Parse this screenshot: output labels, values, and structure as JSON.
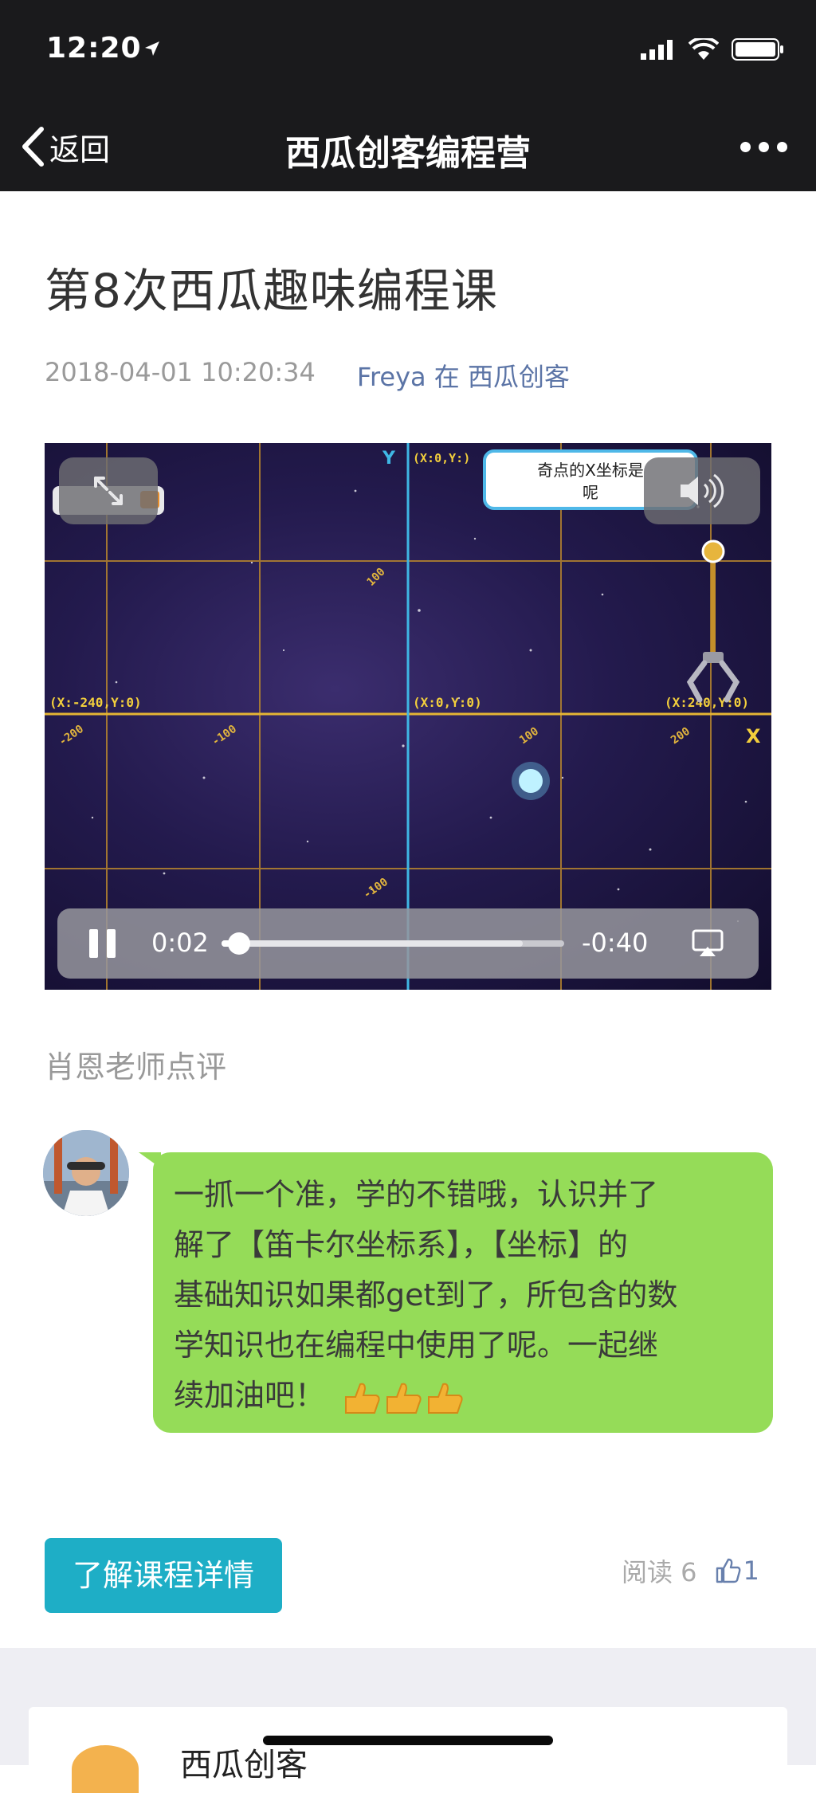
{
  "status_bar": {
    "time": "12:20",
    "icons": [
      "location-arrow-icon",
      "signal-icon",
      "wifi-icon",
      "battery-icon"
    ]
  },
  "nav": {
    "back_label": "返回",
    "title": "西瓜创客编程营",
    "more_icon": "more-dots-icon"
  },
  "article": {
    "title": "第8次西瓜趣味编程课",
    "datetime": "2018-04-01 10:20:34",
    "author": "Freya 在 西瓜创客"
  },
  "video": {
    "scene": {
      "y_axis_label": "Y",
      "x_axis_label": "X",
      "coord_top": "(X:0,Y:)",
      "coord_left": "(X:-240,Y:0)",
      "coord_center": "(X:0,Y:0)",
      "coord_right": "(X:240,Y:0)",
      "tick_100_top": "100",
      "tick_n200": "-200",
      "tick_n100": "-100",
      "tick_100": "100",
      "tick_200": "200",
      "tick_n100_bottom": "-100",
      "speech_line1": "奇点的X坐标是",
      "speech_line2": "呢"
    },
    "controls": {
      "current_time": "0:02",
      "remaining_time": "-0:40",
      "progress_fraction": 0.05,
      "buffered_fraction": 0.88
    }
  },
  "comment": {
    "section_label": "肖恩老师点评",
    "lines": [
      "一抓一个准，学的不错哦，认识并了",
      "解了【笛卡尔坐标系】，【坐标】的",
      "基础知识如果都get到了，所包含的数",
      "学知识也在编程中使用了呢。一起继",
      "续加油吧！"
    ],
    "bubble_color": "#95dc58"
  },
  "footer": {
    "course_button_label": "了解课程详情",
    "read_label": "阅读 6",
    "like_count": "1",
    "accent_color": "#1eaec6"
  },
  "account_card": {
    "name": "西瓜创客"
  }
}
